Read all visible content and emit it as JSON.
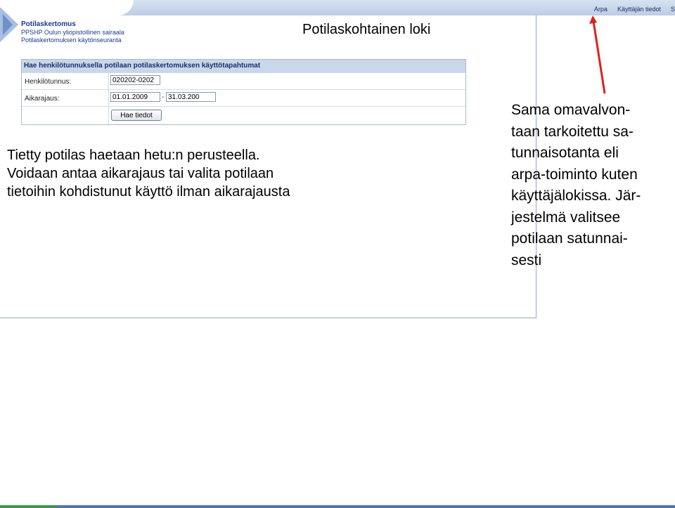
{
  "header": {
    "links": [
      "Arpa",
      "Käyttäjän tiedot",
      "S"
    ]
  },
  "app": {
    "title": "Potilaskertomus",
    "subtitle_1": "PPSHP Oulun yliopistollinen sairaala",
    "subtitle_2": "Potilaskertomuksen käytönseuranta"
  },
  "page_title": "Potilaskohtainen loki",
  "form": {
    "header": "Hae henkilötunnuksella potilaan potilaskertomuksen käyttötapahtumat",
    "ssn_label": "Henkilötunnus:",
    "ssn_value": "020202-0202",
    "range_label": "Aikarajaus:",
    "range_start": "01.01.2009",
    "range_sep": "-",
    "range_end": "31.03.200",
    "submit_label": "Hae tiedot"
  },
  "description": [
    "Tietty potilas haetaan hetu:n perusteella.",
    "Voidaan antaa aikarajaus tai valita potilaan",
    "tietoihin kohdistunut käyttö ilman aikarajausta"
  ],
  "note": [
    "Sama omavalvon-",
    "taan tarkoitettu sa-",
    "tunnaisotanta eli",
    "arpa-toiminto kuten",
    "käyttäjälokissa. Jär-",
    "jestelmä valitsee",
    "potilaan satunnai-",
    "sesti"
  ],
  "colors": {
    "topbar": "#c8d7ea",
    "brand_text": "#1a3a8c",
    "arrow": "#e02020"
  }
}
